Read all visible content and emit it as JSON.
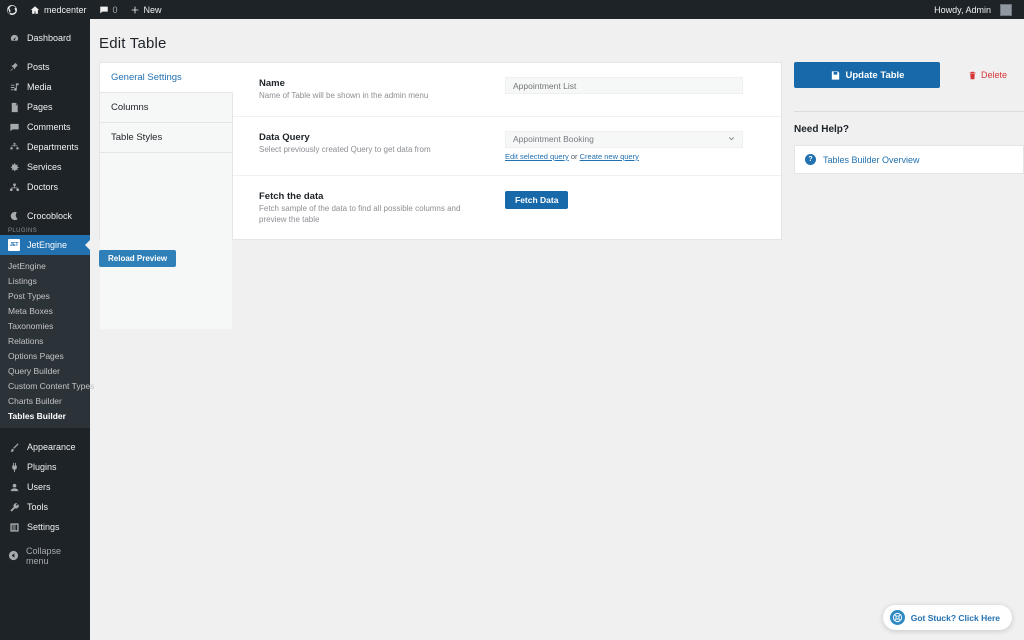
{
  "adminbar": {
    "logo_icon": "wordpress-icon",
    "site_name": "medcenter",
    "home_icon": "home-icon",
    "comments_icon": "comment-bubble-icon",
    "comments_count": "0",
    "new_icon": "plus-icon",
    "new_label": "New",
    "howdy": "Howdy, Admin",
    "avatar_icon": "user-avatar-icon"
  },
  "sidebar": {
    "items": [
      {
        "label": "Dashboard",
        "icon": "dashboard-icon"
      },
      {
        "label": "Posts",
        "icon": "pin-icon"
      },
      {
        "label": "Media",
        "icon": "media-icon"
      },
      {
        "label": "Pages",
        "icon": "page-icon"
      },
      {
        "label": "Comments",
        "icon": "comment-bubble-icon"
      },
      {
        "label": "Departments",
        "icon": "departments-icon"
      },
      {
        "label": "Services",
        "icon": "gear-icon"
      },
      {
        "label": "Doctors",
        "icon": "doctors-icon"
      },
      {
        "label": "Crocoblock",
        "icon": "crocoblock-moon-icon"
      }
    ],
    "plugins_label": "PLUGINS",
    "jetengine": {
      "label": "JetEngine",
      "badge": "JET",
      "icon": "jetengine-icon"
    },
    "submenu": [
      "JetEngine",
      "Listings",
      "Post Types",
      "Meta Boxes",
      "Taxonomies",
      "Relations",
      "Options Pages",
      "Query Builder",
      "Custom Content Types",
      "Charts Builder",
      "Tables Builder"
    ],
    "submenu_current": "Tables Builder",
    "bottom_items": [
      {
        "label": "Appearance",
        "icon": "brush-icon"
      },
      {
        "label": "Plugins",
        "icon": "plug-icon"
      },
      {
        "label": "Users",
        "icon": "user-icon"
      },
      {
        "label": "Tools",
        "icon": "wrench-icon"
      },
      {
        "label": "Settings",
        "icon": "settings-sliders-icon"
      }
    ],
    "collapse": {
      "label": "Collapse menu",
      "icon": "collapse-arrow-icon"
    }
  },
  "page": {
    "title": "Edit Table"
  },
  "tabs": [
    {
      "label": "General Settings",
      "active": true
    },
    {
      "label": "Columns",
      "active": false
    },
    {
      "label": "Table Styles",
      "active": false
    }
  ],
  "fields": {
    "name": {
      "title": "Name",
      "desc": "Name of Table will be shown in the admin menu",
      "placeholder": "Appointment List",
      "value": ""
    },
    "data_query": {
      "title": "Data Query",
      "desc": "Select previously created Query to get data from",
      "selected": "Appointment Booking",
      "chevron_icon": "chevron-down-icon",
      "edit_link": "Edit selected query",
      "or_text": " or ",
      "create_link": "Create new query"
    },
    "fetch": {
      "title": "Fetch the data",
      "desc": "Fetch sample of the data to find all possible columns and preview the table",
      "button_label": "Fetch Data"
    }
  },
  "buttons": {
    "reload_preview": "Reload Preview",
    "update_table": "Update Table",
    "update_icon": "save-disk-icon",
    "delete": "Delete",
    "delete_icon": "trash-icon"
  },
  "help": {
    "title": "Need Help?",
    "link_label": "Tables Builder Overview",
    "link_icon": "question-circle-icon"
  },
  "got_stuck": {
    "label": "Got Stuck? Click Here",
    "icon": "lifebuoy-icon"
  },
  "colors": {
    "admin_bar_bg": "#1d2327",
    "sidebar_bg": "#1d2327",
    "submenu_bg": "#2c3338",
    "accent_blue": "#2271b1",
    "button_blue": "#1769aa",
    "delete_red": "#d63638",
    "page_bg": "#f0f0f1"
  }
}
